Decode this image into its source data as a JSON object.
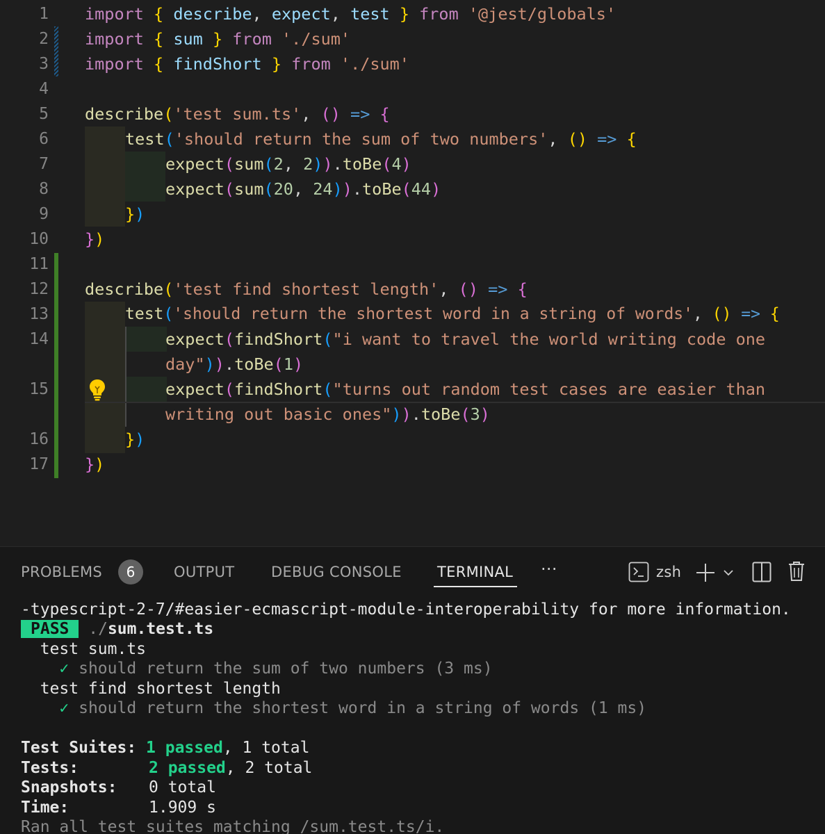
{
  "editor": {
    "line_numbers": [
      "1",
      "2",
      "3",
      "4",
      "5",
      "6",
      "7",
      "8",
      "9",
      "10",
      "11",
      "12",
      "13",
      "14",
      "15",
      "16",
      "17"
    ],
    "l1": {
      "import": "import",
      "open": "{",
      "describe": "describe",
      "c1": ",",
      "expect": "expect",
      "c2": ",",
      "test": "test",
      "close": "}",
      "from": "from",
      "path": "'@jest/globals'"
    },
    "l2": {
      "import": "import",
      "open": "{",
      "sum": "sum",
      "close": "}",
      "from": "from",
      "path": "'./sum'"
    },
    "l3": {
      "import": "import",
      "open": "{",
      "findShort": "findShort",
      "close": "}",
      "from": "from",
      "path": "'./sum'"
    },
    "l5": {
      "fn": "describe",
      "open": "(",
      "str": "'test sum.ts'",
      "comma": ",",
      "params": "()",
      "arrow": "=>",
      "brace": "{"
    },
    "l6": {
      "fn": "test",
      "open": "(",
      "str": "'should return the sum of two numbers'",
      "comma": ",",
      "params": "()",
      "arrow": "=>",
      "brace": "{"
    },
    "l7": {
      "expect": "expect",
      "p1": "(",
      "sum": "sum",
      "p2": "(",
      "a": "2",
      "comma": ",",
      "b": "2",
      "p3": ")",
      "p4": ")",
      "dot": ".",
      "toBe": "toBe",
      "p5": "(",
      "r": "4",
      "p6": ")"
    },
    "l8": {
      "expect": "expect",
      "p1": "(",
      "sum": "sum",
      "p2": "(",
      "a": "20",
      "comma": ",",
      "b": "24",
      "p3": ")",
      "p4": ")",
      "dot": ".",
      "toBe": "toBe",
      "p5": "(",
      "r": "44",
      "p6": ")"
    },
    "l9": {
      "brace": "}",
      "paren": ")"
    },
    "l10": {
      "brace": "}",
      "paren": ")"
    },
    "l12": {
      "fn": "describe",
      "open": "(",
      "str": "'test find shortest length'",
      "comma": ",",
      "params": "()",
      "arrow": "=>",
      "brace": "{"
    },
    "l13": {
      "fn": "test",
      "open": "(",
      "str": "'should return the shortest word in a string of words'",
      "comma": ",",
      "params": "()",
      "arrow": "=>",
      "brace": "{"
    },
    "l14": {
      "expect": "expect",
      "p1": "(",
      "fn": "findShort",
      "p2": "(",
      "str_a": "\"i want to travel the world writing code one",
      "str_b": "day\"",
      "p3": ")",
      "p4": ")",
      "dot": ".",
      "toBe": "toBe",
      "p5": "(",
      "r": "1",
      "p6": ")"
    },
    "l15": {
      "expect": "expect",
      "p1": "(",
      "fn": "findShort",
      "p2": "(",
      "str_a": "\"turns out random test cases are easier than",
      "str_b": "writing out basic ones\"",
      "p3": ")",
      "p4": ")",
      "dot": ".",
      "toBe": "toBe",
      "p5": "(",
      "r": "3",
      "p6": ")"
    },
    "l16": {
      "brace": "}",
      "paren": ")"
    },
    "l17": {
      "brace": "}",
      "paren": ")"
    },
    "lightbulb_icon": "lightbulb-icon"
  },
  "panel": {
    "tabs": {
      "problems": "PROBLEMS",
      "problems_count": "6",
      "output": "OUTPUT",
      "debug_console": "DEBUG CONSOLE",
      "terminal": "TERMINAL",
      "more": "···"
    },
    "shell_label": "zsh",
    "icons": [
      "terminal-icon",
      "plus-icon",
      "chevron-down-icon",
      "split-icon",
      "trash-icon"
    ]
  },
  "terminal": {
    "line1": "-typescript-2-7/#easier-ecmascript-module-interoperability for more information.",
    "pass_badge": "PASS",
    "file_prefix": " ./",
    "file_name": "sum.test.ts",
    "suite1": "  test sum.ts",
    "check_mark": "✓",
    "case1": "should return the sum of two numbers (3 ms)",
    "suite2": "  test find shortest length",
    "case2": "should return the shortest word in a string of words (1 ms)",
    "suites_label": "Test Suites:",
    "suites_passed": "1 passed",
    "suites_total": ", 1 total",
    "tests_label": "Tests:",
    "tests_passed": "2 passed",
    "tests_total": ", 2 total",
    "snapshots_label": "Snapshots:",
    "snapshots_value": "0 total",
    "time_label": "Time:",
    "time_value": "1.909 s",
    "ran_line": "Ran all test suites matching /sum.test.ts/i."
  },
  "colors": {
    "background": "#1e1e1e",
    "panel_background": "#181818",
    "pass_green": "#23d18b",
    "added_gutter": "#3f7f27",
    "modified_gutter": "#1e5a8a"
  }
}
